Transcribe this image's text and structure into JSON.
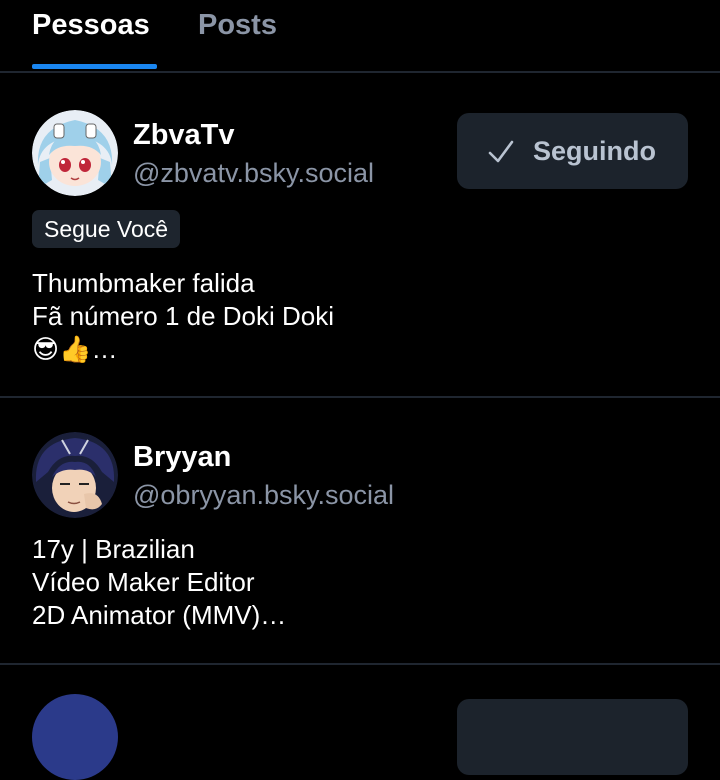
{
  "tabs": [
    {
      "label": "Pessoas",
      "active": true
    },
    {
      "label": "Posts",
      "active": false
    }
  ],
  "colors": {
    "background": "#000000",
    "accent": "#1a86f0",
    "muted_text": "#8b95a6",
    "divider": "#1f2630",
    "button_bg": "#1c232c"
  },
  "users": [
    {
      "display_name": "ZbvaTv",
      "handle": "@zbvatv.bsky.social",
      "follow_button_label": "Seguindo",
      "follow_button_icon": "check-icon",
      "badge": "Segue Você",
      "bio": "Thumbmaker falida\nFã número 1 de Doki Doki\n😎👍…"
    },
    {
      "display_name": "Bryyan",
      "handle": "@obryyan.bsky.social",
      "bio": "17y | Brazilian\nVídeo Maker Editor\n2D Animator (MMV)…"
    }
  ]
}
